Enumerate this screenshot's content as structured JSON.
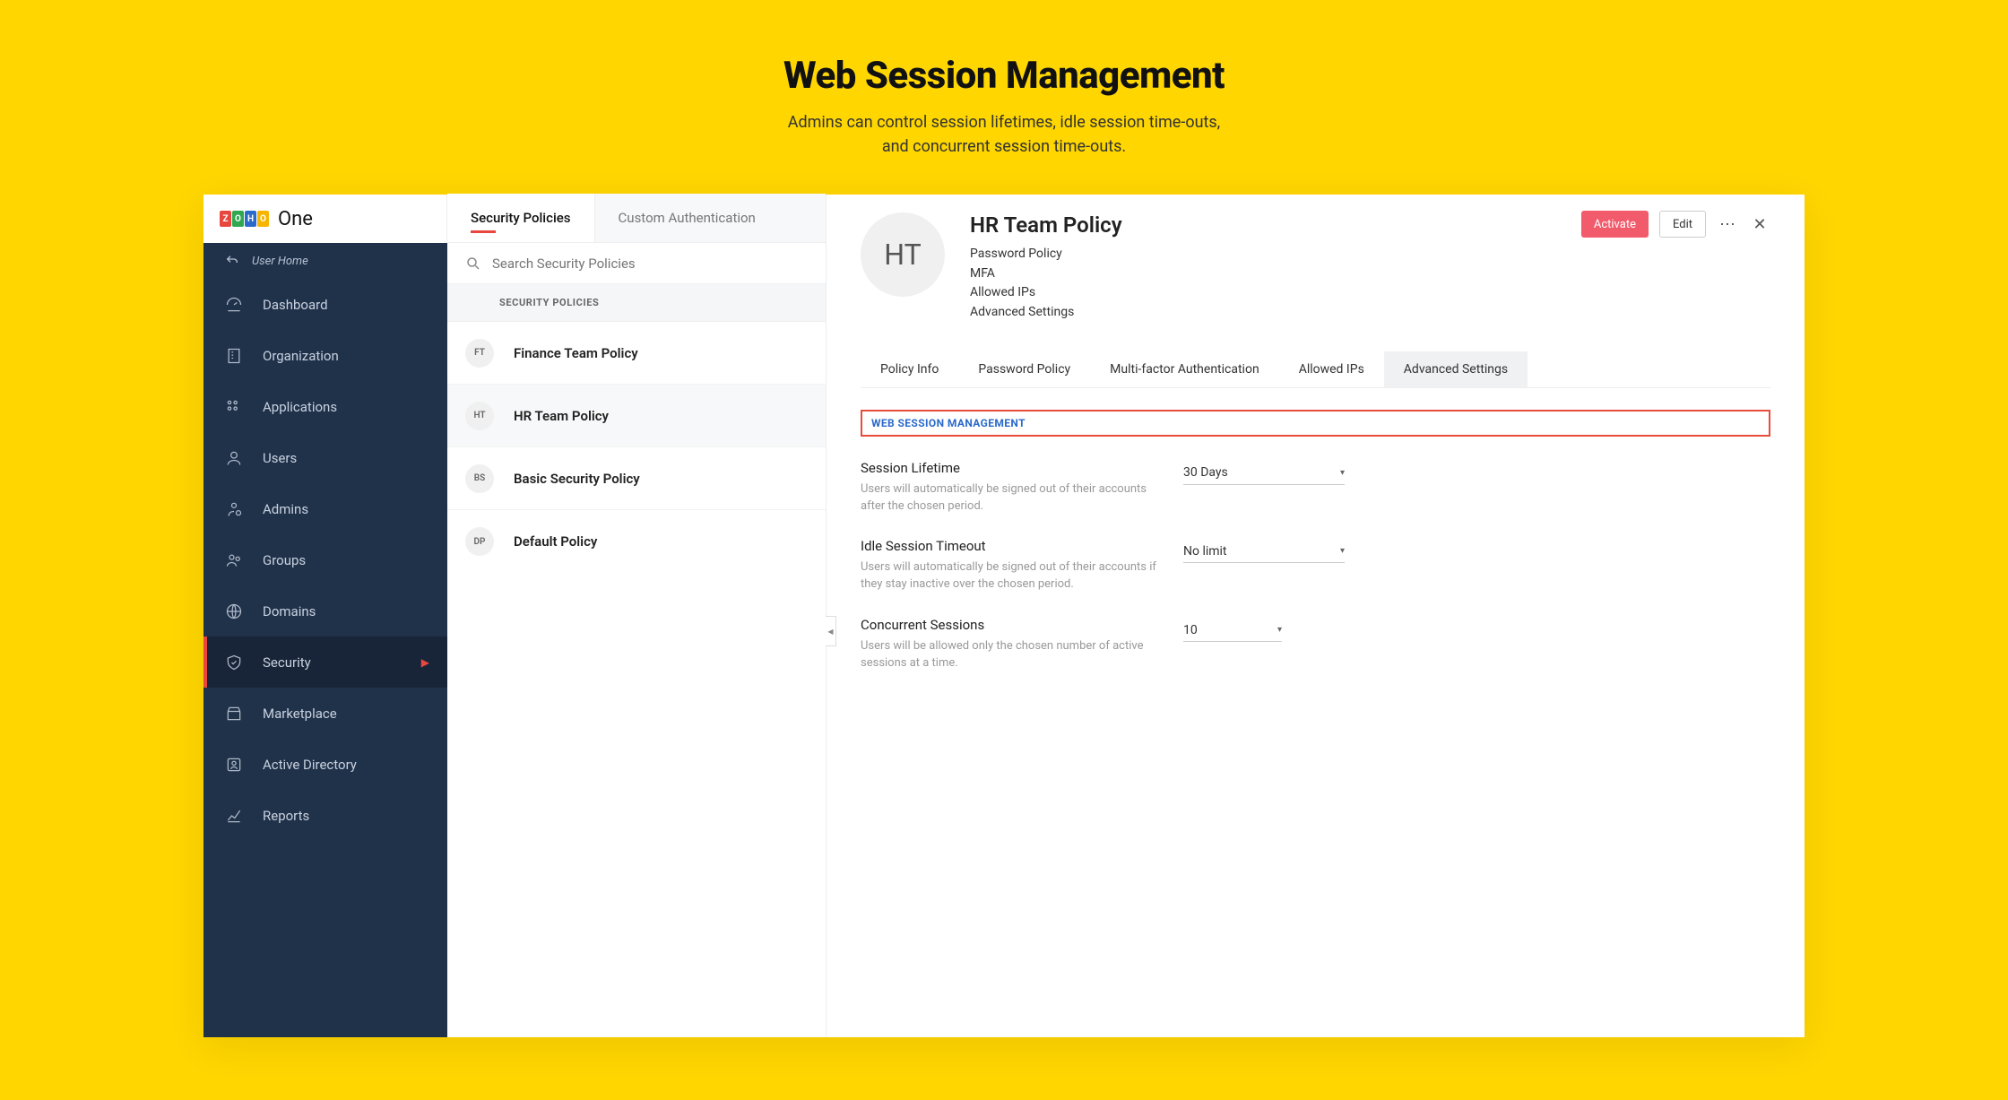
{
  "hero": {
    "title": "Web Session Management",
    "subtitle_line1": "Admins can control session lifetimes, idle session time-outs,",
    "subtitle_line2": "and concurrent session time-outs."
  },
  "logo": {
    "suffix": "One"
  },
  "user_home_label": "User Home",
  "sidebar": {
    "items": [
      {
        "label": "Dashboard"
      },
      {
        "label": "Organization"
      },
      {
        "label": "Applications"
      },
      {
        "label": "Users"
      },
      {
        "label": "Admins"
      },
      {
        "label": "Groups"
      },
      {
        "label": "Domains"
      },
      {
        "label": "Security"
      },
      {
        "label": "Marketplace"
      },
      {
        "label": "Active Directory"
      },
      {
        "label": "Reports"
      }
    ]
  },
  "mid_tabs": {
    "tab1": "Security Policies",
    "tab2": "Custom Authentication"
  },
  "search": {
    "placeholder": "Search Security Policies"
  },
  "list_header": "SECURITY POLICIES",
  "policies": [
    {
      "initials": "FT",
      "name": "Finance Team Policy"
    },
    {
      "initials": "HT",
      "name": "HR Team Policy"
    },
    {
      "initials": "BS",
      "name": "Basic Security Policy"
    },
    {
      "initials": "DP",
      "name": "Default Policy"
    }
  ],
  "detail": {
    "avatar_initials": "HT",
    "title": "HR Team Policy",
    "meta": {
      "l1": "Password Policy",
      "l2": "MFA",
      "l3": "Allowed IPs",
      "l4": "Advanced Settings"
    },
    "actions": {
      "activate": "Activate",
      "edit": "Edit"
    },
    "subtabs": {
      "t1": "Policy Info",
      "t2": "Password Policy",
      "t3": "Multi-factor Authentication",
      "t4": "Allowed IPs",
      "t5": "Advanced Settings"
    },
    "section_title": "WEB SESSION MANAGEMENT",
    "settings": [
      {
        "label": "Session Lifetime",
        "desc": "Users will automatically be signed out of their accounts after the chosen period.",
        "value": "30 Days"
      },
      {
        "label": "Idle Session Timeout",
        "desc": "Users will automatically be signed out of their accounts if they stay inactive over the chosen period.",
        "value": "No limit"
      },
      {
        "label": "Concurrent Sessions",
        "desc": "Users will be allowed only the chosen number of active sessions at a time.",
        "value": "10"
      }
    ]
  }
}
